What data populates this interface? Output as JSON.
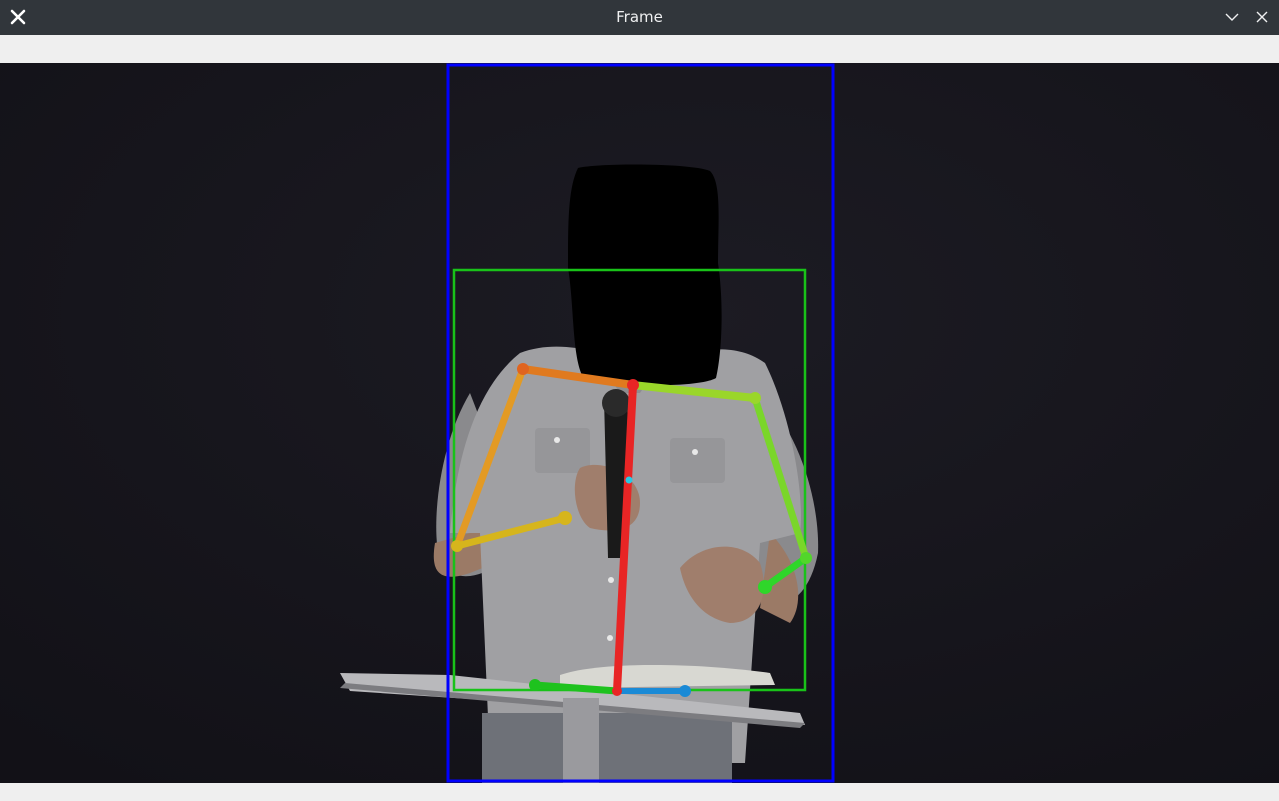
{
  "window": {
    "title": "Frame"
  },
  "icons": {
    "app": "close-x-icon",
    "minimize": "chevron-down-icon",
    "close": "close-icon"
  },
  "colors": {
    "person_box": "#0000ff",
    "torso_box": "#19c219",
    "spine": "#e82525",
    "left_arm_upper": "#e07a1f",
    "left_arm_lower": "#d6b51c",
    "right_arm": "#7ad62a",
    "right_hand": "#2fd62a",
    "hips_left": "#1ec21e",
    "hips_right": "#1a8ad6",
    "mid_point": "#29c9e3"
  }
}
